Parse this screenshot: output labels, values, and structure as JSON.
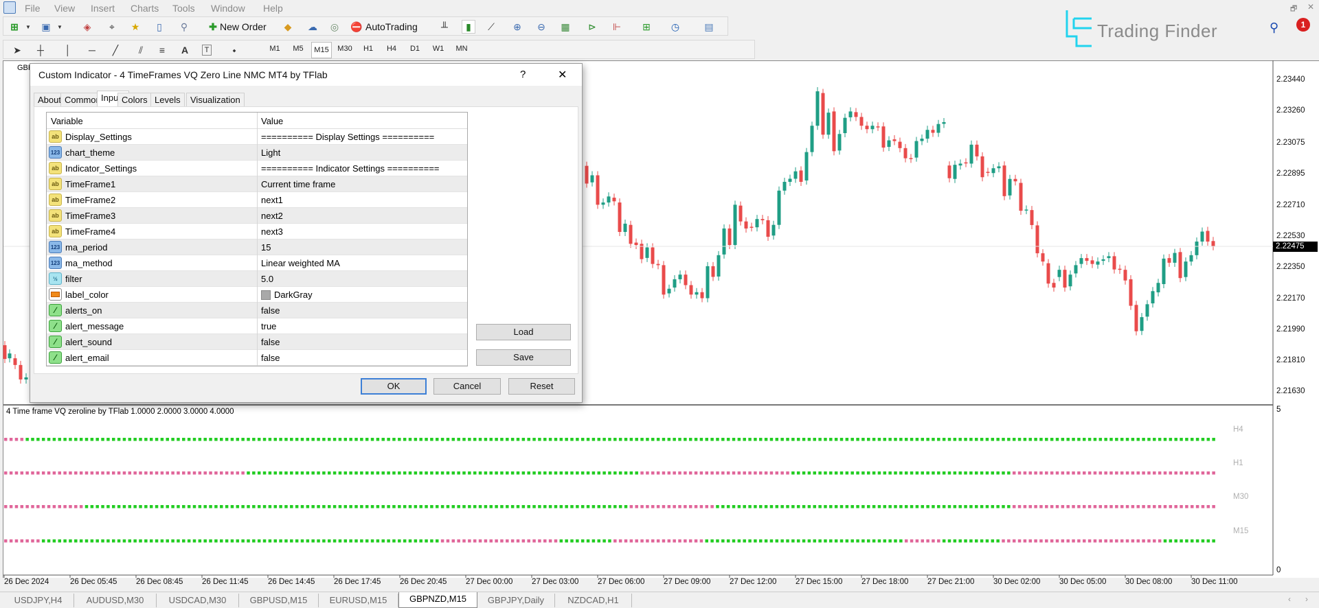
{
  "menu": [
    "File",
    "View",
    "Insert",
    "Charts",
    "Tools",
    "Window",
    "Help"
  ],
  "toolbar": {
    "new_order_label": "New Order",
    "autotrading_label": "AutoTrading",
    "timeframes": [
      "M1",
      "M5",
      "M15",
      "M30",
      "H1",
      "H4",
      "D1",
      "W1",
      "MN"
    ],
    "active_timeframe": "M15"
  },
  "branding": {
    "logo_text": "Trading Finder",
    "notification_count": "1"
  },
  "chart": {
    "symbol_label": "GBP",
    "current_price": "2.22475",
    "price_ticks": [
      "2.23440",
      "2.23260",
      "2.23075",
      "2.22895",
      "2.22710",
      "2.22530",
      "2.22350",
      "2.22170",
      "2.21990",
      "2.21810",
      "2.21630"
    ],
    "time_labels": [
      "26 Dec 2024",
      "26 Dec 05:45",
      "26 Dec 08:45",
      "26 Dec 11:45",
      "26 Dec 14:45",
      "26 Dec 17:45",
      "26 Dec 20:45",
      "27 Dec 00:00",
      "27 Dec 03:00",
      "27 Dec 06:00",
      "27 Dec 09:00",
      "27 Dec 12:00",
      "27 Dec 15:00",
      "27 Dec 18:00",
      "27 Dec 21:00",
      "30 Dec 02:00",
      "30 Dec 05:00",
      "30 Dec 08:00",
      "30 Dec 11:00"
    ],
    "colors": {
      "bull": "#1f9e85",
      "bear": "#e94b4b"
    },
    "left_edge_candles": [
      [
        2.21901,
        2.21821
      ],
      [
        2.21825,
        2.21853
      ],
      [
        2.21825,
        2.21786
      ],
      [
        2.21786,
        2.21702
      ],
      [
        2.21702,
        2.21714
      ]
    ],
    "candles_open_close": [
      [
        2.22943,
        2.2284
      ],
      [
        2.22847,
        2.22888
      ],
      [
        2.22888,
        2.22717
      ],
      [
        2.22717,
        2.2273
      ],
      [
        2.2273,
        2.22765
      ],
      [
        2.22758,
        2.22737
      ],
      [
        2.2273,
        2.22559
      ],
      [
        2.22559,
        2.22607
      ],
      [
        2.226,
        2.2249
      ],
      [
        2.22497,
        2.22483
      ],
      [
        2.2249,
        2.22401
      ],
      [
        2.22408,
        2.22469
      ],
      [
        2.22469,
        2.22373
      ],
      [
        2.22373,
        2.22366
      ],
      [
        2.22366,
        2.22195
      ],
      [
        2.22202,
        2.22229
      ],
      [
        2.22236,
        2.22284
      ],
      [
        2.22284,
        2.22311
      ],
      [
        2.22311,
        2.2225
      ],
      [
        2.2225,
        2.22195
      ],
      [
        2.22195,
        2.22209
      ],
      [
        2.22209,
        2.22174
      ],
      [
        2.22174,
        2.2236
      ],
      [
        2.2236,
        2.22298
      ],
      [
        2.223,
        2.22424
      ],
      [
        2.22428,
        2.22579
      ],
      [
        2.22579,
        2.22483
      ],
      [
        2.22483,
        2.22717
      ],
      [
        2.22712,
        2.2262
      ],
      [
        2.2262,
        2.22579
      ],
      [
        2.22589,
        2.22586
      ],
      [
        2.22586,
        2.22634
      ],
      [
        2.22634,
        2.22627
      ],
      [
        2.22627,
        2.22531
      ],
      [
        2.22538,
        2.226
      ],
      [
        2.226,
        2.22799
      ],
      [
        2.22799,
        2.2285
      ],
      [
        2.2285,
        2.22868
      ],
      [
        2.22868,
        2.22911
      ],
      [
        2.22916,
        2.2285
      ],
      [
        2.22858,
        2.23023
      ],
      [
        2.23023,
        2.23176
      ],
      [
        2.23176,
        2.23376
      ],
      [
        2.23366,
        2.23124
      ],
      [
        2.23124,
        2.23252
      ],
      [
        2.23259,
        2.23028
      ],
      [
        2.23032,
        2.23128
      ],
      [
        2.23133,
        2.23222
      ],
      [
        2.23225,
        2.23259
      ],
      [
        2.23255,
        2.23227
      ],
      [
        2.23227,
        2.23176
      ],
      [
        2.23176,
        2.23156
      ],
      [
        2.23156,
        2.23176
      ],
      [
        2.23172,
        2.2317
      ],
      [
        2.23172,
        2.23049
      ],
      [
        2.23053,
        2.23091
      ],
      [
        2.23097,
        2.23087
      ],
      [
        2.23083,
        2.23046
      ],
      [
        2.23046,
        2.22987
      ],
      [
        2.22988,
        2.22984
      ],
      [
        2.22991,
        2.23087
      ],
      [
        2.23087,
        2.23101
      ],
      [
        2.23101,
        2.23152
      ],
      [
        2.23152,
        2.23135
      ],
      [
        2.23135,
        2.23186
      ],
      [
        2.23187,
        2.23197
      ],
      [
        2.22945,
        2.22871
      ],
      [
        2.22867,
        2.22949
      ],
      [
        2.22945,
        2.22956
      ],
      [
        2.22963,
        2.22959
      ],
      [
        2.22956,
        2.23066
      ],
      [
        2.23066,
        2.22998
      ],
      [
        2.22998,
        2.22877
      ],
      [
        2.22908,
        2.22906
      ],
      [
        2.22901,
        2.22929
      ],
      [
        2.22929,
        2.2294
      ],
      [
        2.22945,
        2.22767
      ],
      [
        2.22771,
        2.22867
      ],
      [
        2.22867,
        2.22853
      ],
      [
        2.22844,
        2.22682
      ],
      [
        2.22686,
        2.22689
      ],
      [
        2.22686,
        2.22599
      ],
      [
        2.22597,
        2.22435
      ],
      [
        2.22435,
        2.22387
      ],
      [
        2.22377,
        2.22259
      ],
      [
        2.22263,
        2.22236
      ],
      [
        2.22297,
        2.22339
      ],
      [
        2.22339,
        2.22236
      ],
      [
        2.22243,
        2.22311
      ],
      [
        2.22318,
        2.22366
      ],
      [
        2.22373,
        2.22407
      ],
      [
        2.22407,
        2.22391
      ],
      [
        2.22394,
        2.22373
      ],
      [
        2.22369,
        2.22387
      ],
      [
        2.22391,
        2.224
      ],
      [
        2.22407,
        2.22418
      ],
      [
        2.22418,
        2.22341
      ],
      [
        2.22345,
        2.22339
      ],
      [
        2.22339,
        2.22277
      ],
      [
        2.22284,
        2.2213
      ],
      [
        2.22135,
        2.21982
      ],
      [
        2.21984,
        2.22064
      ],
      [
        2.22067,
        2.22139
      ],
      [
        2.22144,
        2.22215
      ],
      [
        2.22208,
        2.22263
      ],
      [
        2.22256,
        2.22404
      ],
      [
        2.22407,
        2.2238
      ],
      [
        2.2238,
        2.22437
      ],
      [
        2.22442,
        2.22291
      ],
      [
        2.22297,
        2.22387
      ],
      [
        2.22387,
        2.22424
      ],
      [
        2.22424,
        2.22503
      ],
      [
        2.22503,
        2.22561
      ],
      [
        2.22565,
        2.22503
      ],
      [
        2.22506,
        2.22476
      ]
    ]
  },
  "indicator": {
    "label": "4 Time frame VQ zeroline by TFlab 1.0000 2.0000 3.0000 4.0000",
    "axis_max": "5",
    "axis_min": "0",
    "colors": {
      "up": "#22cc22",
      "down": "#e0669a"
    },
    "rows": [
      {
        "name": "H4",
        "runs": [
          [
            "down",
            4
          ],
          [
            "up",
            221
          ]
        ]
      },
      {
        "name": "H1",
        "runs": [
          [
            "down",
            45
          ],
          [
            "up",
            73
          ],
          [
            "down",
            28
          ],
          [
            "up",
            41
          ],
          [
            "down",
            38
          ]
        ]
      },
      {
        "name": "M30",
        "runs": [
          [
            "down",
            15
          ],
          [
            "up",
            101
          ],
          [
            "down",
            16
          ],
          [
            "up",
            55
          ],
          [
            "down",
            38
          ]
        ]
      },
      {
        "name": "M15",
        "runs": [
          [
            "down",
            7
          ],
          [
            "up",
            74
          ],
          [
            "down",
            22
          ],
          [
            "up",
            10
          ],
          [
            "down",
            17
          ],
          [
            "up",
            37
          ],
          [
            "down",
            7
          ],
          [
            "up",
            11
          ],
          [
            "down",
            30
          ],
          [
            "up",
            10
          ]
        ]
      }
    ]
  },
  "symbol_tabs": [
    {
      "label": "USDJPY,H4"
    },
    {
      "label": "AUDUSD,M30"
    },
    {
      "label": "USDCAD,M30"
    },
    {
      "label": "GBPUSD,M15"
    },
    {
      "label": "EURUSD,M15"
    },
    {
      "label": "GBPNZD,M15",
      "active": true
    },
    {
      "label": "GBPJPY,Daily"
    },
    {
      "label": "NZDCAD,H1"
    }
  ],
  "dialog": {
    "title": "Custom Indicator - 4 TimeFrames VQ Zero Line NMC MT4 by TFlab",
    "help": "?",
    "close": "✕",
    "tabs": [
      "About",
      "Common",
      "Inputs",
      "Colors",
      "Levels",
      "Visualization"
    ],
    "active_tab": "Inputs",
    "columns": [
      "Variable",
      "Value"
    ],
    "inputs": [
      {
        "icon": "ab",
        "variable": "Display_Settings",
        "value": "========== Display Settings =========="
      },
      {
        "icon": "num",
        "variable": "chart_theme",
        "value": "Light"
      },
      {
        "icon": "ab",
        "variable": "Indicator_Settings",
        "value": "========== Indicator Settings =========="
      },
      {
        "icon": "ab",
        "variable": "TimeFrame1",
        "value": "Current time frame"
      },
      {
        "icon": "ab",
        "variable": "TimeFrame2",
        "value": "next1"
      },
      {
        "icon": "ab",
        "variable": "TimeFrame3",
        "value": "next2"
      },
      {
        "icon": "ab",
        "variable": "TimeFrame4",
        "value": "next3"
      },
      {
        "icon": "num",
        "variable": "ma_period",
        "value": "15"
      },
      {
        "icon": "num",
        "variable": "ma_method",
        "value": "Linear weighted MA"
      },
      {
        "icon": "frac",
        "variable": "filter",
        "value": "5.0"
      },
      {
        "icon": "color",
        "variable": "label_color",
        "value": "DarkGray",
        "swatch": "#a9a9a9"
      },
      {
        "icon": "alert",
        "variable": "alerts_on",
        "value": "false"
      },
      {
        "icon": "alert",
        "variable": "alert_message",
        "value": "true"
      },
      {
        "icon": "alert",
        "variable": "alert_sound",
        "value": "false"
      },
      {
        "icon": "alert",
        "variable": "alert_email",
        "value": "false"
      }
    ],
    "buttons": {
      "load": "Load",
      "save": "Save",
      "ok": "OK",
      "cancel": "Cancel",
      "reset": "Reset"
    }
  }
}
